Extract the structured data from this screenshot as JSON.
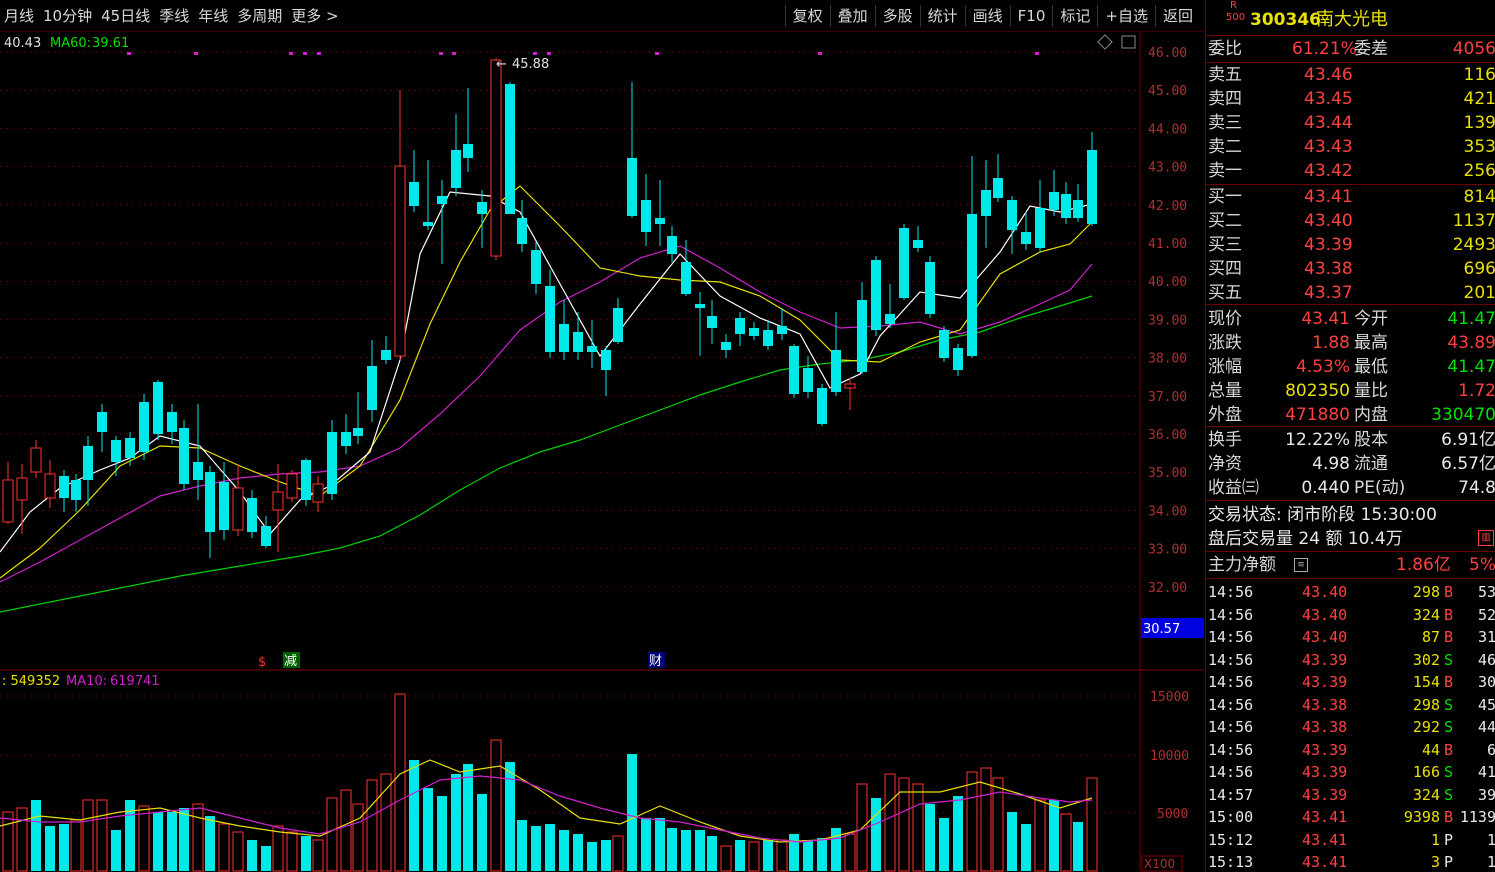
{
  "toolbar": {
    "left": [
      "月线",
      "10分钟",
      "45日线",
      "季线",
      "年线",
      "多周期",
      "更多 >"
    ],
    "right": [
      "复权",
      "叠加",
      "多股",
      "统计",
      "画线",
      "F10",
      "标记",
      "+自选",
      "返回"
    ]
  },
  "chart": {
    "ma_legend": {
      "ma_a": "40.43",
      "ma60_label": "MA60:",
      "ma60": "39.61"
    },
    "peak_label": "45.88",
    "price_labels": [
      "46.00",
      "45.00",
      "44.00",
      "43.00",
      "42.00",
      "41.00",
      "40.00",
      "39.00",
      "38.00",
      "37.00",
      "36.00",
      "35.00",
      "34.00",
      "33.00",
      "32.00"
    ],
    "current_marker": "30.57",
    "markers": [
      "$",
      "减",
      "财"
    ],
    "vol_legend": {
      "vol": ": 549352",
      "ma10_label": "MA10:",
      "ma10": "619741"
    },
    "vol_labels": [
      "15000",
      "10000",
      "5000"
    ],
    "vol_unit": "X100"
  },
  "chart_data": {
    "type": "candlestick",
    "series": [
      {
        "name": "MA60",
        "value": 39.61
      },
      {
        "name": "MA10",
        "value": 619741
      }
    ],
    "ylim": [
      32.0,
      46.0
    ],
    "peak": 45.88,
    "last": {
      "open": 41.47,
      "high": 43.89,
      "low": 41.47,
      "close": 43.41
    }
  },
  "panel": {
    "badge_top": "R",
    "badge_bottom": "500",
    "code": "300346",
    "name": "南大光电",
    "webi": {
      "label": "委比",
      "value": "61.21%",
      "label2": "委差",
      "value2": "4056"
    },
    "asks": [
      {
        "label": "卖五",
        "price": "43.46",
        "vol": "116"
      },
      {
        "label": "卖四",
        "price": "43.45",
        "vol": "421"
      },
      {
        "label": "卖三",
        "price": "43.44",
        "vol": "139"
      },
      {
        "label": "卖二",
        "price": "43.43",
        "vol": "353"
      },
      {
        "label": "卖一",
        "price": "43.42",
        "vol": "256"
      }
    ],
    "bids": [
      {
        "label": "买一",
        "price": "43.41",
        "vol": "814"
      },
      {
        "label": "买二",
        "price": "43.40",
        "vol": "1137"
      },
      {
        "label": "买三",
        "price": "43.39",
        "vol": "2493"
      },
      {
        "label": "买四",
        "price": "43.38",
        "vol": "696"
      },
      {
        "label": "买五",
        "price": "43.37",
        "vol": "201"
      }
    ],
    "stats": [
      {
        "l1": "现价",
        "v1": "43.41",
        "c1": "red",
        "l2": "今开",
        "v2": "41.47",
        "c2": "grn"
      },
      {
        "l1": "涨跌",
        "v1": "1.88",
        "c1": "red",
        "l2": "最高",
        "v2": "43.89",
        "c2": "red"
      },
      {
        "l1": "涨幅",
        "v1": "4.53%",
        "c1": "red",
        "l2": "最低",
        "v2": "41.47",
        "c2": "grn"
      },
      {
        "l1": "总量",
        "v1": "802350",
        "c1": "yel",
        "l2": "量比",
        "v2": "1.72",
        "c2": "red"
      },
      {
        "l1": "外盘",
        "v1": "471880",
        "c1": "red",
        "l2": "内盘",
        "v2": "330470",
        "c2": "grn"
      }
    ],
    "stats2": [
      {
        "l1": "换手",
        "v1": "12.22%",
        "l2": "股本",
        "v2": "6.91亿"
      },
      {
        "l1": "净资",
        "v1": "4.98",
        "l2": "流通",
        "v2": "6.57亿"
      },
      {
        "l1": "收益㈢",
        "v1": "0.440",
        "l2": "PE(动)",
        "v2": "74.8"
      }
    ],
    "status_line": "交易状态: 闭市阶段 15:30:00",
    "after_hours": "盘后交易量 24 额 10.4万",
    "main_force": {
      "label": "主力净额",
      "value": "1.86亿",
      "pct": "5%"
    },
    "ticks": [
      {
        "t": "14:56",
        "p": "43.40",
        "v": "298",
        "s": "B",
        "n": "53"
      },
      {
        "t": "14:56",
        "p": "43.40",
        "v": "324",
        "s": "B",
        "n": "52"
      },
      {
        "t": "14:56",
        "p": "43.40",
        "v": "87",
        "s": "B",
        "n": "31"
      },
      {
        "t": "14:56",
        "p": "43.39",
        "v": "302",
        "s": "S",
        "n": "46"
      },
      {
        "t": "14:56",
        "p": "43.39",
        "v": "154",
        "s": "B",
        "n": "30"
      },
      {
        "t": "14:56",
        "p": "43.38",
        "v": "298",
        "s": "S",
        "n": "45"
      },
      {
        "t": "14:56",
        "p": "43.38",
        "v": "292",
        "s": "S",
        "n": "44"
      },
      {
        "t": "14:56",
        "p": "43.39",
        "v": "44",
        "s": "B",
        "n": "6"
      },
      {
        "t": "14:56",
        "p": "43.39",
        "v": "166",
        "s": "S",
        "n": "41"
      },
      {
        "t": "14:57",
        "p": "43.39",
        "v": "324",
        "s": "S",
        "n": "39"
      },
      {
        "t": "15:00",
        "p": "43.41",
        "v": "9398",
        "s": "B",
        "n": "1139"
      },
      {
        "t": "15:12",
        "p": "43.41",
        "v": "1",
        "s": "P",
        "n": "1"
      },
      {
        "t": "15:13",
        "p": "43.41",
        "v": "3",
        "s": "P",
        "n": "1"
      }
    ]
  }
}
